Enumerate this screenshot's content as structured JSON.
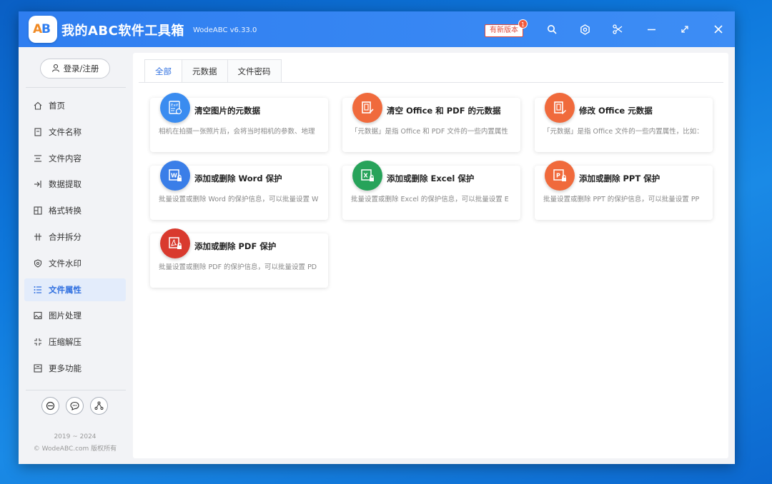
{
  "app": {
    "title": "我的ABC软件工具箱",
    "version": "WodeABC v6.33.0",
    "new_version_label": "有新版本",
    "new_version_badge": "1",
    "logo_a": "A",
    "logo_b": "B"
  },
  "sidebar": {
    "login_label": "登录/注册",
    "items": [
      {
        "label": "首页",
        "icon": "home-icon"
      },
      {
        "label": "文件名称",
        "icon": "file-name-icon"
      },
      {
        "label": "文件内容",
        "icon": "file-content-icon"
      },
      {
        "label": "数据提取",
        "icon": "data-extract-icon"
      },
      {
        "label": "格式转换",
        "icon": "format-convert-icon"
      },
      {
        "label": "合并拆分",
        "icon": "merge-split-icon"
      },
      {
        "label": "文件水印",
        "icon": "watermark-icon"
      },
      {
        "label": "文件属性",
        "icon": "file-properties-icon",
        "active": true
      },
      {
        "label": "图片处理",
        "icon": "image-icon"
      },
      {
        "label": "压缩解压",
        "icon": "compress-icon"
      },
      {
        "label": "更多功能",
        "icon": "more-icon"
      }
    ],
    "copyright_years": "2019 ~ 2024",
    "copyright_text": "© WodeABC.com 版权所有"
  },
  "tabs": [
    {
      "label": "全部",
      "active": true
    },
    {
      "label": "元数据"
    },
    {
      "label": "文件密码"
    }
  ],
  "cards": [
    {
      "title": "清空图片的元数据",
      "desc": "相机在拍摄一张照片后，会将当时相机的参数、地理",
      "color": "#3a8cf0",
      "icon": "exif-icon"
    },
    {
      "title": "清空 Office 和 PDF 的元数据",
      "desc": "「元数据」是指 Office 和 PDF 文件的一些内置属性",
      "color": "#f06a3c",
      "icon": "office-clear-icon"
    },
    {
      "title": "修改 Office 元数据",
      "desc": "「元数据」是指 Office 文件的一些内置属性，比如：",
      "color": "#f06a3c",
      "icon": "office-edit-icon"
    },
    {
      "title": "添加或删除 Word 保护",
      "desc": "批量设置或删除 Word 的保护信息，可以批量设置 W",
      "color": "#3a7ee8",
      "icon": "word-lock-icon"
    },
    {
      "title": "添加或删除 Excel 保护",
      "desc": "批量设置或删除 Excel 的保护信息，可以批量设置 E",
      "color": "#27a35a",
      "icon": "excel-lock-icon"
    },
    {
      "title": "添加或删除 PPT 保护",
      "desc": "批量设置或删除 PPT 的保护信息，可以批量设置 PP",
      "color": "#f06a3c",
      "icon": "ppt-lock-icon"
    },
    {
      "title": "添加或删除 PDF 保护",
      "desc": "批量设置或删除 PDF 的保护信息，可以批量设置 PD",
      "color": "#d93a2e",
      "icon": "pdf-lock-icon"
    }
  ]
}
